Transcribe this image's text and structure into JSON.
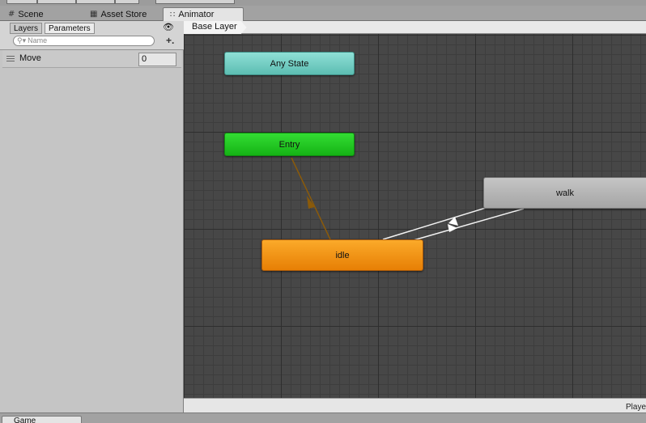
{
  "tabs": [
    {
      "label": "Scene",
      "icon": "grid-icon"
    },
    {
      "label": "Asset Store",
      "icon": "store-icon"
    },
    {
      "label": "Animator",
      "icon": "animator-icon"
    }
  ],
  "left_panel": {
    "subtabs": [
      "Layers",
      "Parameters"
    ],
    "search_placeholder": "Name",
    "parameter": {
      "name": "Move",
      "value": "0"
    }
  },
  "breadcrumb": "Base Layer",
  "states": {
    "any_state": "Any State",
    "entry": "Entry",
    "idle": "idle",
    "walk": "walk"
  },
  "colors": {
    "any_state": "#6fcfc4",
    "entry": "#22c822",
    "default_state": "#f29214",
    "state": "#b5b5b5",
    "graph_background": "#474747"
  },
  "status": "Playe",
  "bottom_tab": "Game"
}
